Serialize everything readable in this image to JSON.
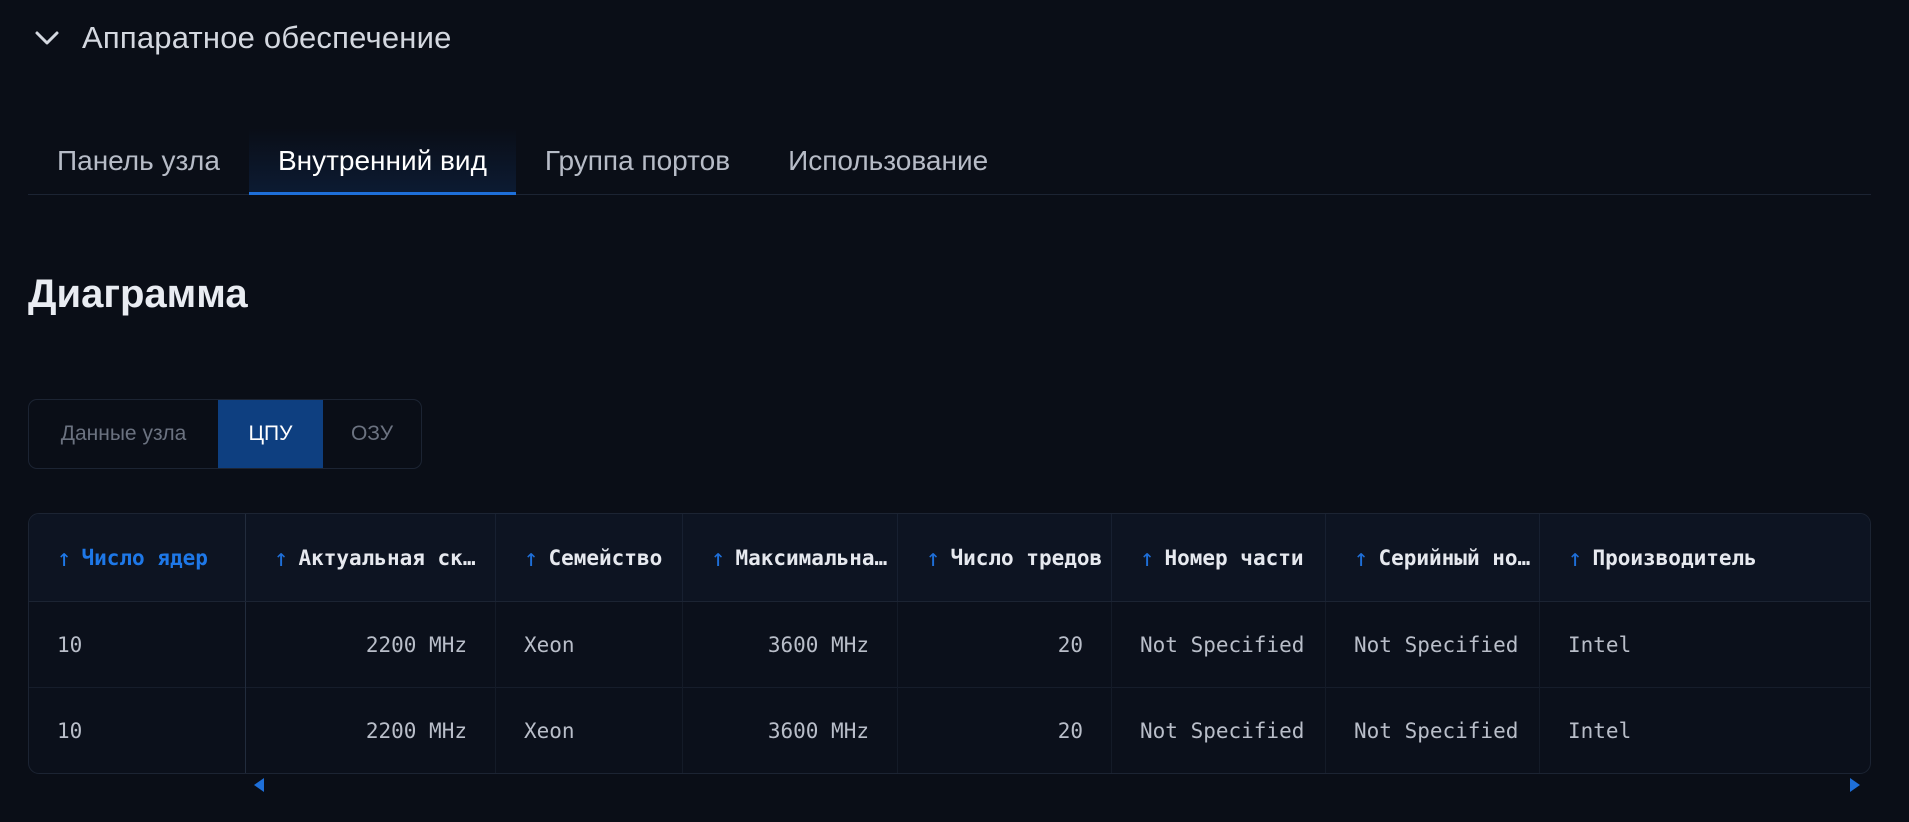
{
  "section": {
    "title": "Аппаратное обеспечение",
    "toggle_icon": "chevron-down-icon"
  },
  "tabs": [
    {
      "label": "Панель узла",
      "active": false
    },
    {
      "label": "Внутренний вид",
      "active": true
    },
    {
      "label": "Группа портов",
      "active": false
    },
    {
      "label": "Использование",
      "active": false
    }
  ],
  "heading": "Диаграмма",
  "segment": [
    {
      "label": "Данные узла",
      "active": false
    },
    {
      "label": "ЦПУ",
      "active": true
    },
    {
      "label": "ОЗУ",
      "active": false
    }
  ],
  "table": {
    "sort_icon": "arrow-up-icon",
    "columns": [
      {
        "label": "Число ядер",
        "sorted": true
      },
      {
        "label": "Актуальная ск…",
        "sorted": false
      },
      {
        "label": "Семейство",
        "sorted": false
      },
      {
        "label": "Максимальна…",
        "sorted": false
      },
      {
        "label": "Число тредов",
        "sorted": false
      },
      {
        "label": "Номер части",
        "sorted": false
      },
      {
        "label": "Серийный но…",
        "sorted": false
      },
      {
        "label": "Производитель",
        "sorted": false
      }
    ],
    "rows": [
      [
        "10",
        "2200 MHz",
        "Xeon",
        "3600 MHz",
        "20",
        "Not Specified",
        "Not Specified",
        "Intel"
      ],
      [
        "10",
        "2200 MHz",
        "Xeon",
        "3600 MHz",
        "20",
        "Not Specified",
        "Not Specified",
        "Intel"
      ]
    ]
  },
  "colors": {
    "accent": "#1e6fd9",
    "background": "#0a0e17",
    "segment_active": "#0e3f80"
  }
}
